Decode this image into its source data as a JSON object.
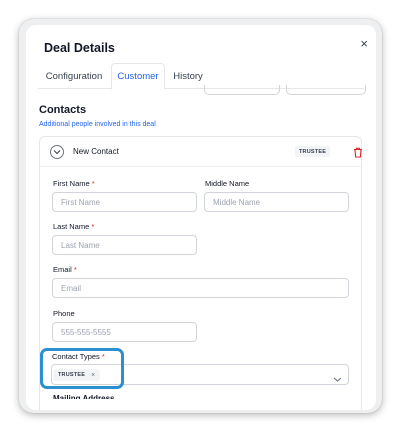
{
  "modal": {
    "title": "Deal Details",
    "close_glyph": "×",
    "tabs": [
      {
        "label": "Configuration",
        "active": false
      },
      {
        "label": "Customer",
        "active": true
      },
      {
        "label": "History",
        "active": false
      }
    ]
  },
  "contacts": {
    "title": "Contacts",
    "subtitle": "Additional people involved in this deal",
    "contact": {
      "name": "New Contact",
      "badge": "TRUSTEE",
      "fields": {
        "first_name": {
          "label": "First Name",
          "required_mark": "*",
          "placeholder": "First Name"
        },
        "middle_name": {
          "label": "Middle Name",
          "placeholder": "Middle Name"
        },
        "last_name": {
          "label": "Last Name",
          "required_mark": "*",
          "placeholder": "Last Name"
        },
        "email": {
          "label": "Email",
          "required_mark": "*",
          "placeholder": "Email"
        },
        "phone": {
          "label": "Phone",
          "placeholder": "555-555-5555"
        },
        "contact_types": {
          "label": "Contact Types",
          "required_mark": "*",
          "selected": [
            "TRUSTEE"
          ],
          "remove_glyph": "×"
        }
      },
      "next_section_label": "Mailing Address"
    }
  },
  "colors": {
    "accent": "#2563eb",
    "highlight": "#2b8fd0",
    "required": "#dc2626",
    "danger": "#dc2626"
  },
  "icons": {
    "close": "close-icon",
    "collapse": "chevron-down-icon",
    "delete": "trash-icon",
    "dropdown": "chevron-down-icon"
  }
}
